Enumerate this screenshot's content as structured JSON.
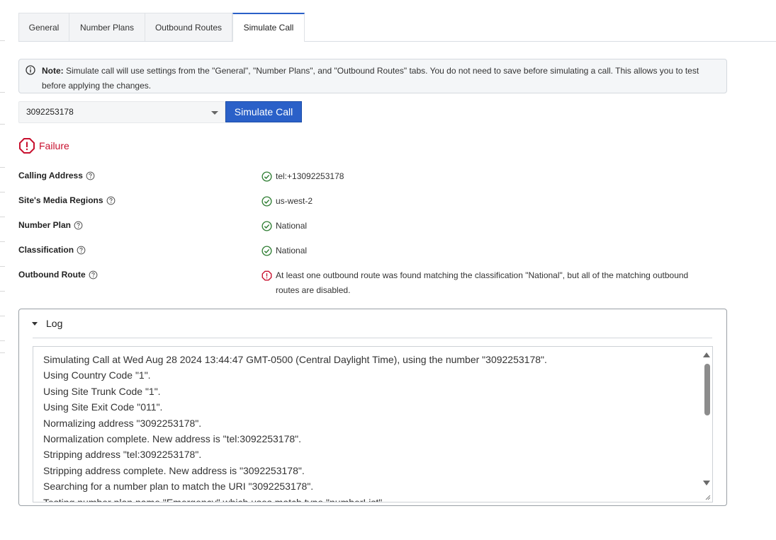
{
  "tabs": [
    {
      "label": "General",
      "active": false
    },
    {
      "label": "Number Plans",
      "active": false
    },
    {
      "label": "Outbound Routes",
      "active": false
    },
    {
      "label": "Simulate Call",
      "active": true
    }
  ],
  "note": {
    "title": "Note:",
    "text": "Simulate call will use settings from the \"General\", \"Number Plans\", and \"Outbound Routes\" tabs. You do not need to save before simulating a call. This allows you to test before applying the changes."
  },
  "number_select": {
    "value": "3092253178"
  },
  "simulate_button": {
    "label": "Simulate Call"
  },
  "result": {
    "status": "Failure",
    "color": "#c8102e"
  },
  "checks": [
    {
      "label": "Calling Address",
      "status": "ok",
      "value": "tel:+13092253178"
    },
    {
      "label": "Site's Media Regions",
      "status": "ok",
      "value": "us-west-2"
    },
    {
      "label": "Number Plan",
      "status": "ok",
      "value": "National"
    },
    {
      "label": "Classification",
      "status": "ok",
      "value": "National"
    },
    {
      "label": "Outbound Route",
      "status": "error",
      "value": "At least one outbound route was found matching the classification \"National\", but all of the matching outbound routes are disabled."
    }
  ],
  "log": {
    "title": "Log",
    "lines": [
      "Simulating Call at Wed Aug 28 2024 13:44:47 GMT-0500 (Central Daylight Time), using the number \"3092253178\".",
      "Using Country Code \"1\".",
      "Using Site Trunk Code \"1\".",
      "Using Site Exit Code \"011\".",
      "Normalizing address \"3092253178\".",
      "Normalization complete. New address is \"tel:3092253178\".",
      "Stripping address \"tel:3092253178\".",
      "Stripping address complete. New address is \"3092253178\".",
      "Searching for a number plan to match the URI \"3092253178\".",
      "Testing number plan name \"Emergency\" which uses match type \"numberList\"."
    ]
  },
  "colors": {
    "accent": "#2a60c8",
    "success": "#2e7d32",
    "error": "#c8102e"
  }
}
